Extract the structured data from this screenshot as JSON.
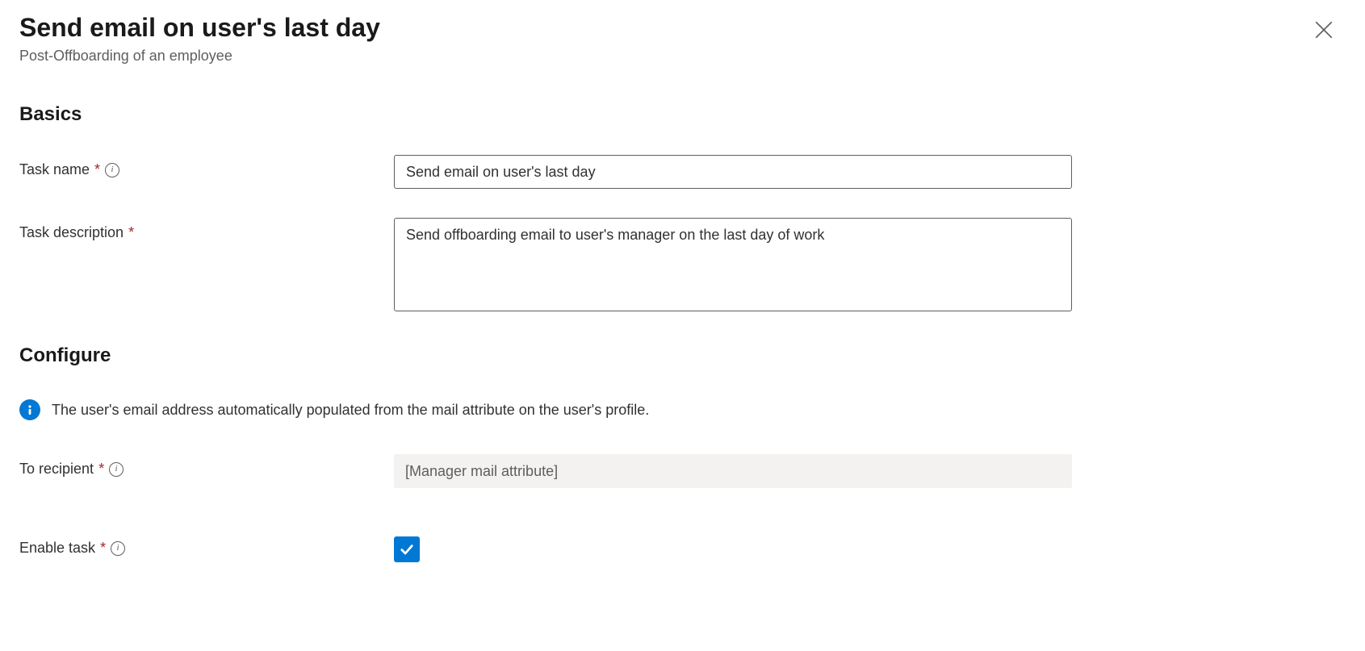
{
  "header": {
    "title": "Send email on user's last day",
    "subtitle": "Post-Offboarding of an employee"
  },
  "sections": {
    "basics": "Basics",
    "configure": "Configure"
  },
  "fields": {
    "taskName": {
      "label": "Task name",
      "value": "Send email on user's last day"
    },
    "taskDescription": {
      "label": "Task description",
      "value": "Send offboarding email to user's manager on the last day of work"
    },
    "toRecipient": {
      "label": "To recipient",
      "value": "[Manager mail attribute]"
    },
    "enableTask": {
      "label": "Enable task",
      "checked": true
    }
  },
  "infoBanner": "The user's email address automatically populated from the mail attribute on the user's profile."
}
